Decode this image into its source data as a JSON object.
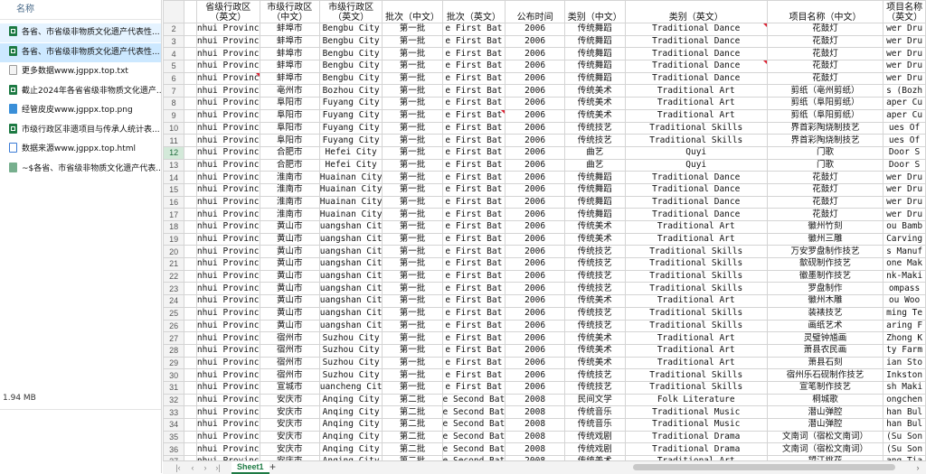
{
  "explorer": {
    "header": "名称",
    "files": [
      {
        "name": "各省、市省级非物质文化遗产代表性...",
        "icon": "excel-icon",
        "state": "hover"
      },
      {
        "name": "各省、市省级非物质文化遗产代表性...",
        "icon": "excel-icon",
        "state": "selected"
      },
      {
        "name": "更多数据www.jgppx.top.txt",
        "icon": "text-file-icon",
        "state": ""
      },
      {
        "name": "截止2024年各省省级非物质文化遗产...",
        "icon": "excel-icon",
        "state": ""
      },
      {
        "name": "经管皮皮www.jgppx.top.png",
        "icon": "image-file-icon",
        "state": ""
      },
      {
        "name": "市级行政区非遗项目与传承人统计表...",
        "icon": "excel-icon",
        "state": ""
      },
      {
        "name": "数据来源www.jgppx.top.html",
        "icon": "html-file-icon",
        "state": ""
      },
      {
        "name": "~$各省、市省级非物质文化遗产代表...",
        "icon": "temp-excel-icon",
        "state": ""
      }
    ],
    "size": "1.94 MB"
  },
  "sheet": {
    "headers": [
      "",
      "",
      "省级行政区（英文）",
      "市级行政区（中文）",
      "市级行政区（英文）",
      "批次（中文）",
      "批次（英文）",
      "公布时间",
      "类别（中文）",
      "类别（英文）",
      "项目名称（中文）",
      "项目名称（英文）"
    ],
    "rows": [
      {
        "n": "2",
        "p": "nhui Provinc",
        "c": "蚌埠市",
        "ce": "Bengbu City",
        "b": "第一批",
        "be": "e First Bat",
        "y": "2006",
        "k": "传统舞蹈",
        "ke": "Traditional Dance",
        "x": "花鼓灯",
        "xe": "wer Dru"
      },
      {
        "n": "3",
        "p": "nhui Provinc",
        "c": "蚌埠市",
        "ce": "Bengbu City",
        "b": "第一批",
        "be": "e First Bat",
        "y": "2006",
        "k": "传统舞蹈",
        "ke": "Traditional Dance",
        "x": "花鼓灯",
        "xe": "wer Dru"
      },
      {
        "n": "4",
        "p": "nhui Provinc",
        "c": "蚌埠市",
        "ce": "Bengbu City",
        "b": "第一批",
        "be": "e First Bat",
        "y": "2006",
        "k": "传统舞蹈",
        "ke": "Traditional Dance",
        "x": "花鼓灯",
        "xe": "wer Dru"
      },
      {
        "n": "5",
        "p": "nhui Provinc",
        "c": "蚌埠市",
        "ce": "Bengbu City",
        "b": "第一批",
        "be": "e First Bat",
        "y": "2006",
        "k": "传统舞蹈",
        "ke": "Traditional Dance",
        "x": "花鼓灯",
        "xe": "wer Dru"
      },
      {
        "n": "6",
        "p": "nhui Provinc",
        "c": "蚌埠市",
        "ce": "Bengbu City",
        "b": "第一批",
        "be": "e First Bat",
        "y": "2006",
        "k": "传统舞蹈",
        "ke": "Traditional Dance",
        "x": "花鼓灯",
        "xe": "wer Dru"
      },
      {
        "n": "7",
        "p": "nhui Provinc",
        "c": "亳州市",
        "ce": "Bozhou City",
        "b": "第一批",
        "be": "e First Bat",
        "y": "2006",
        "k": "传统美术",
        "ke": "Traditional Art",
        "x": "剪纸（亳州剪纸）",
        "xe": "s (Bozh"
      },
      {
        "n": "8",
        "p": "nhui Provinc",
        "c": "阜阳市",
        "ce": "Fuyang City",
        "b": "第一批",
        "be": "e First Bat",
        "y": "2006",
        "k": "传统美术",
        "ke": "Traditional Art",
        "x": "剪纸（阜阳剪纸）",
        "xe": "aper Cu"
      },
      {
        "n": "9",
        "p": "nhui Provinc",
        "c": "阜阳市",
        "ce": "Fuyang City",
        "b": "第一批",
        "be": "e First Bat",
        "y": "2006",
        "k": "传统美术",
        "ke": "Traditional Art",
        "x": "剪纸（阜阳剪纸）",
        "xe": "aper Cu"
      },
      {
        "n": "10",
        "p": "nhui Provinc",
        "c": "阜阳市",
        "ce": "Fuyang City",
        "b": "第一批",
        "be": "e First Bat",
        "y": "2006",
        "k": "传统技艺",
        "ke": "Traditional Skills",
        "x": "界首彩陶烧制技艺",
        "xe": "ues Of"
      },
      {
        "n": "11",
        "p": "nhui Provinc",
        "c": "阜阳市",
        "ce": "Fuyang City",
        "b": "第一批",
        "be": "e First Bat",
        "y": "2006",
        "k": "传统技艺",
        "ke": "Traditional Skills",
        "x": "界首彩陶烧制技艺",
        "xe": "ues Of"
      },
      {
        "n": "12",
        "p": "nhui Provinc",
        "c": "合肥市",
        "ce": "Hefei City",
        "b": "第一批",
        "be": "e First Bat",
        "y": "2006",
        "k": "曲艺",
        "ke": "Quyi",
        "x": "门歌",
        "xe": "Door S"
      },
      {
        "n": "13",
        "p": "nhui Provinc",
        "c": "合肥市",
        "ce": "Hefei City",
        "b": "第一批",
        "be": "e First Bat",
        "y": "2006",
        "k": "曲艺",
        "ke": "Quyi",
        "x": "门歌",
        "xe": "Door S"
      },
      {
        "n": "14",
        "p": "nhui Provinc",
        "c": "淮南市",
        "ce": "Huainan City",
        "b": "第一批",
        "be": "e First Bat",
        "y": "2006",
        "k": "传统舞蹈",
        "ke": "Traditional Dance",
        "x": "花鼓灯",
        "xe": "wer Dru"
      },
      {
        "n": "15",
        "p": "nhui Provinc",
        "c": "淮南市",
        "ce": "Huainan City",
        "b": "第一批",
        "be": "e First Bat",
        "y": "2006",
        "k": "传统舞蹈",
        "ke": "Traditional Dance",
        "x": "花鼓灯",
        "xe": "wer Dru"
      },
      {
        "n": "16",
        "p": "nhui Provinc",
        "c": "淮南市",
        "ce": "Huainan City",
        "b": "第一批",
        "be": "e First Bat",
        "y": "2006",
        "k": "传统舞蹈",
        "ke": "Traditional Dance",
        "x": "花鼓灯",
        "xe": "wer Dru"
      },
      {
        "n": "17",
        "p": "nhui Provinc",
        "c": "淮南市",
        "ce": "Huainan City",
        "b": "第一批",
        "be": "e First Bat",
        "y": "2006",
        "k": "传统舞蹈",
        "ke": "Traditional Dance",
        "x": "花鼓灯",
        "xe": "wer Dru"
      },
      {
        "n": "18",
        "p": "nhui Provinc",
        "c": "黄山市",
        "ce": "uangshan Cit",
        "b": "第一批",
        "be": "e First Bat",
        "y": "2006",
        "k": "传统美术",
        "ke": "Traditional Art",
        "x": "徽州竹刻",
        "xe": "ou Bamb"
      },
      {
        "n": "19",
        "p": "nhui Provinc",
        "c": "黄山市",
        "ce": "uangshan Cit",
        "b": "第一批",
        "be": "e First Bat",
        "y": "2006",
        "k": "传统美术",
        "ke": "Traditional Art",
        "x": "徽州三雕",
        "xe": "Carving"
      },
      {
        "n": "20",
        "p": "nhui Provinc",
        "c": "黄山市",
        "ce": "uangshan Cit",
        "b": "第一批",
        "be": "e First Bat",
        "y": "2006",
        "k": "传统技艺",
        "ke": "Traditional Skills",
        "x": "万安罗盘制作技艺",
        "xe": "s Manuf"
      },
      {
        "n": "21",
        "p": "nhui Provinc",
        "c": "黄山市",
        "ce": "uangshan Cit",
        "b": "第一批",
        "be": "e First Bat",
        "y": "2006",
        "k": "传统技艺",
        "ke": "Traditional Skills",
        "x": "歙砚制作技艺",
        "xe": "one Mak"
      },
      {
        "n": "22",
        "p": "nhui Provinc",
        "c": "黄山市",
        "ce": "uangshan Cit",
        "b": "第一批",
        "be": "e First Bat",
        "y": "2006",
        "k": "传统技艺",
        "ke": "Traditional Skills",
        "x": "徽墨制作技艺",
        "xe": "nk-Maki"
      },
      {
        "n": "23",
        "p": "nhui Provinc",
        "c": "黄山市",
        "ce": "uangshan Cit",
        "b": "第一批",
        "be": "e First Bat",
        "y": "2006",
        "k": "传统技艺",
        "ke": "Traditional Skills",
        "x": "罗盘制作",
        "xe": "ompass"
      },
      {
        "n": "24",
        "p": "nhui Provinc",
        "c": "黄山市",
        "ce": "uangshan Cit",
        "b": "第一批",
        "be": "e First Bat",
        "y": "2006",
        "k": "传统美术",
        "ke": "Traditional Art",
        "x": "徽州木雕",
        "xe": "ou Woo"
      },
      {
        "n": "25",
        "p": "nhui Provinc",
        "c": "黄山市",
        "ce": "uangshan Cit",
        "b": "第一批",
        "be": "e First Bat",
        "y": "2006",
        "k": "传统技艺",
        "ke": "Traditional Skills",
        "x": "装裱技艺",
        "xe": "ming Te"
      },
      {
        "n": "26",
        "p": "nhui Provinc",
        "c": "黄山市",
        "ce": "uangshan Cit",
        "b": "第一批",
        "be": "e First Bat",
        "y": "2006",
        "k": "传统技艺",
        "ke": "Traditional Skills",
        "x": "画纸艺术",
        "xe": "aring F"
      },
      {
        "n": "27",
        "p": "nhui Provinc",
        "c": "宿州市",
        "ce": "Suzhou City",
        "b": "第一批",
        "be": "e First Bat",
        "y": "2006",
        "k": "传统美术",
        "ke": "Traditional Art",
        "x": "灵璧钟馗画",
        "xe": "Zhong K"
      },
      {
        "n": "28",
        "p": "nhui Provinc",
        "c": "宿州市",
        "ce": "Suzhou City",
        "b": "第一批",
        "be": "e First Bat",
        "y": "2006",
        "k": "传统美术",
        "ke": "Traditional Art",
        "x": "萧县农民画",
        "xe": "ty Farm"
      },
      {
        "n": "29",
        "p": "nhui Provinc",
        "c": "宿州市",
        "ce": "Suzhou City",
        "b": "第一批",
        "be": "e First Bat",
        "y": "2006",
        "k": "传统美术",
        "ke": "Traditional Art",
        "x": "萧县石刻",
        "xe": "ian Sto"
      },
      {
        "n": "30",
        "p": "nhui Provinc",
        "c": "宿州市",
        "ce": "Suzhou City",
        "b": "第一批",
        "be": "e First Bat",
        "y": "2006",
        "k": "传统技艺",
        "ke": "Traditional Skills",
        "x": "宿州乐石砚制作技艺",
        "xe": "Inkston"
      },
      {
        "n": "31",
        "p": "nhui Provinc",
        "c": "宣城市",
        "ce": "uancheng Cit",
        "b": "第一批",
        "be": "e First Bat",
        "y": "2006",
        "k": "传统技艺",
        "ke": "Traditional Skills",
        "x": "宣笔制作技艺",
        "xe": "sh Maki"
      },
      {
        "n": "32",
        "p": "nhui Provinc",
        "c": "安庆市",
        "ce": "Anqing City",
        "b": "第二批",
        "be": "e Second Bat",
        "y": "2008",
        "k": "民间文学",
        "ke": "Folk Literature",
        "x": "桐城歌",
        "xe": "ongchen"
      },
      {
        "n": "33",
        "p": "nhui Provinc",
        "c": "安庆市",
        "ce": "Anqing City",
        "b": "第二批",
        "be": "e Second Bat",
        "y": "2008",
        "k": "传统音乐",
        "ke": "Traditional Music",
        "x": "潜山弹腔",
        "xe": "han Bul"
      },
      {
        "n": "34",
        "p": "nhui Provinc",
        "c": "安庆市",
        "ce": "Anqing City",
        "b": "第二批",
        "be": "e Second Bat",
        "y": "2008",
        "k": "传统音乐",
        "ke": "Traditional Music",
        "x": "潜山弹腔",
        "xe": "han Bul"
      },
      {
        "n": "35",
        "p": "nhui Provinc",
        "c": "安庆市",
        "ce": "Anqing City",
        "b": "第二批",
        "be": "e Second Bat",
        "y": "2008",
        "k": "传统戏剧",
        "ke": "Traditional Drama",
        "x": "文南词（宿松文南词）",
        "xe": "(Su Son"
      },
      {
        "n": "36",
        "p": "nhui Provinc",
        "c": "安庆市",
        "ce": "Anqing City",
        "b": "第二批",
        "be": "e Second Bat",
        "y": "2008",
        "k": "传统戏剧",
        "ke": "Traditional Drama",
        "x": "文南词（宿松文南词）",
        "xe": "(Su Son"
      },
      {
        "n": "37",
        "p": "nhui Provinc",
        "c": "安庆市",
        "ce": "Anqing City",
        "b": "第二批",
        "be": "e Second Bat",
        "y": "2008",
        "k": "传统美术",
        "ke": "Traditional Art",
        "x": "望江挑花",
        "xe": "ang Tia"
      },
      {
        "n": "38",
        "p": "nhui Provinc",
        "c": "安庆市",
        "ce": "Anqing City",
        "b": "第二批",
        "be": "e Second Bat",
        "y": "2008",
        "k": "传统美术",
        "ke": "Traditional Art",
        "x": "望江挑花",
        "xe": "ang Tia"
      },
      {
        "n": "39",
        "p": "nhui Provinc",
        "c": "安庆市",
        "ce": "Anqing City",
        "b": "第二批",
        "be": "e Second Bat",
        "y": "2008",
        "k": "传统技艺",
        "ke": "Traditional Skills",
        "x": "桑皮纸制作技艺",
        "xe": "sh Paper"
      }
    ]
  },
  "tabbar": {
    "sheet_name": "Sheet1",
    "add_label": "+"
  }
}
